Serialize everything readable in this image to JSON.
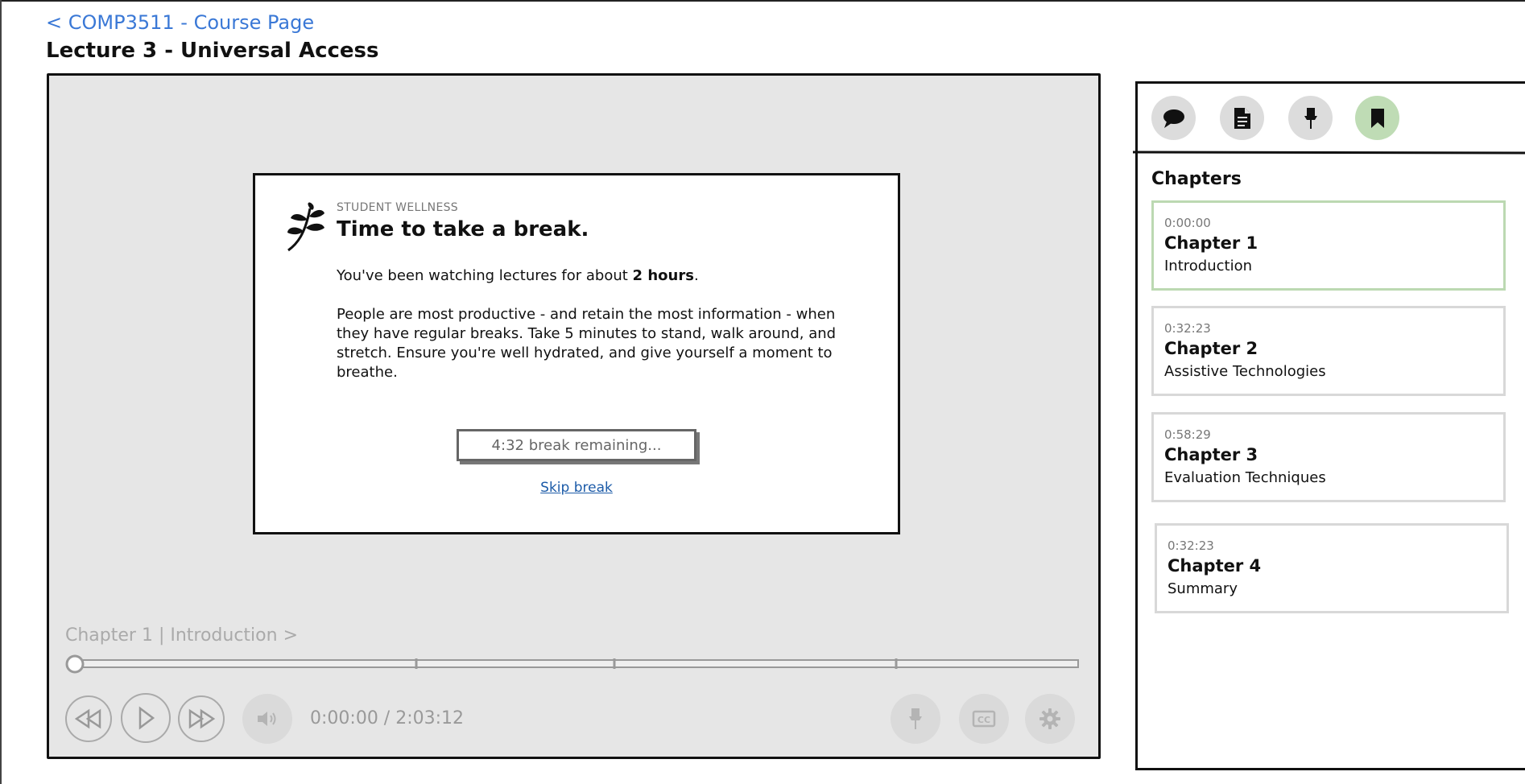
{
  "header": {
    "back_link": "< COMP3511 - Course Page",
    "title": "Lecture 3 - Universal Access"
  },
  "modal": {
    "eyebrow": "STUDENT WELLNESS",
    "title": "Time to take a break.",
    "p1_before": "You've been watching lectures for about ",
    "p1_bold": "2 hours",
    "p1_after": ".",
    "p2": "People are most productive - and retain the most information - when they have regular breaks. Take 5 minutes to stand, walk around, and stretch. Ensure you're well hydrated, and give yourself a moment to breathe.",
    "timer": "4:32 break remaining...",
    "skip": "Skip break",
    "icon": "leaf-icon"
  },
  "player": {
    "chapter_label": "Chapter 1 | Introduction >",
    "time": "0:00:00 / 2:03:12",
    "progress": 0,
    "controls": [
      "rewind-icon",
      "play-icon",
      "fast-forward-icon",
      "volume-icon",
      "pin-icon",
      "cc-icon",
      "gear-icon"
    ]
  },
  "sidebar": {
    "tabs": [
      "chat-icon",
      "document-icon",
      "pin-icon",
      "bookmark-icon"
    ],
    "active_tab": "bookmark-icon",
    "heading": "Chapters",
    "chapters": [
      {
        "time": "0:00:00",
        "title": "Chapter 1",
        "subtitle": "Introduction"
      },
      {
        "time": "0:32:23",
        "title": "Chapter 2",
        "subtitle": "Assistive Technologies"
      },
      {
        "time": "0:58:29",
        "title": "Chapter 3",
        "subtitle": "Evaluation Techniques"
      },
      {
        "time": "0:32:23",
        "title": "Chapter 4",
        "subtitle": "Summary"
      }
    ]
  },
  "colors": {
    "link": "#3a78d6",
    "active_green": "#bfdcb5",
    "player_bg": "#e6e6e6"
  }
}
